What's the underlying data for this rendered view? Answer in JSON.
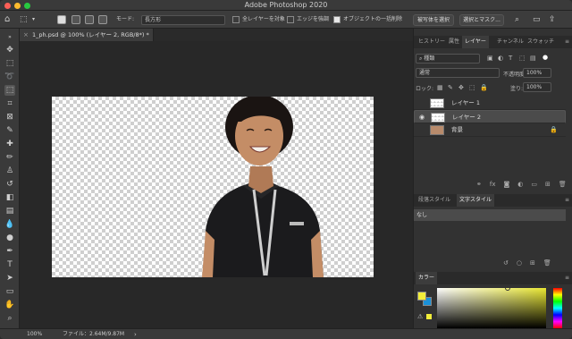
{
  "window": {
    "title": "Adobe Photoshop 2020"
  },
  "options_bar": {
    "mode_label": "モード:",
    "shape_value": "長方形",
    "all_layers_label": "全レイヤーを対象",
    "enhance_edge_label": "エッジを強調",
    "object_subtract_label": "オブジェクトの一括削除",
    "select_subject_button": "被写体を選択",
    "select_mask_button": "選択とマスク..."
  },
  "document": {
    "tab_label": "1_ph.psd @ 100% (レイヤー 2, RGB/8*) *",
    "modified": "*"
  },
  "panels": {
    "top_tabs": [
      "ヒストリー",
      "属性",
      "レイヤー",
      "チャンネル",
      "スウォッチ"
    ],
    "active_top_tab": "レイヤー",
    "filter_kind": "種類",
    "blend_mode": "通常",
    "opacity_label": "不透明度:",
    "opacity_value": "100%",
    "lock_label": "ロック:",
    "fill_label": "塗り:",
    "fill_value": "100%",
    "layers": [
      {
        "name": "レイヤー 1",
        "visible": false,
        "selected": false
      },
      {
        "name": "レイヤー 2",
        "visible": true,
        "selected": true
      },
      {
        "name": "背景",
        "visible": false,
        "selected": false,
        "locked": true
      }
    ],
    "style_tabs": [
      "段落スタイル",
      "文字スタイル"
    ],
    "active_style_tab": "文字スタイル",
    "style_item": "なし",
    "color_tab": "カラー"
  },
  "status": {
    "zoom": "100%",
    "file_info": "ファイル：2.64M/9.87M"
  },
  "colors": {
    "foreground": "#f2ee3a",
    "background": "#1a90d8",
    "accent": "#e8e632"
  }
}
